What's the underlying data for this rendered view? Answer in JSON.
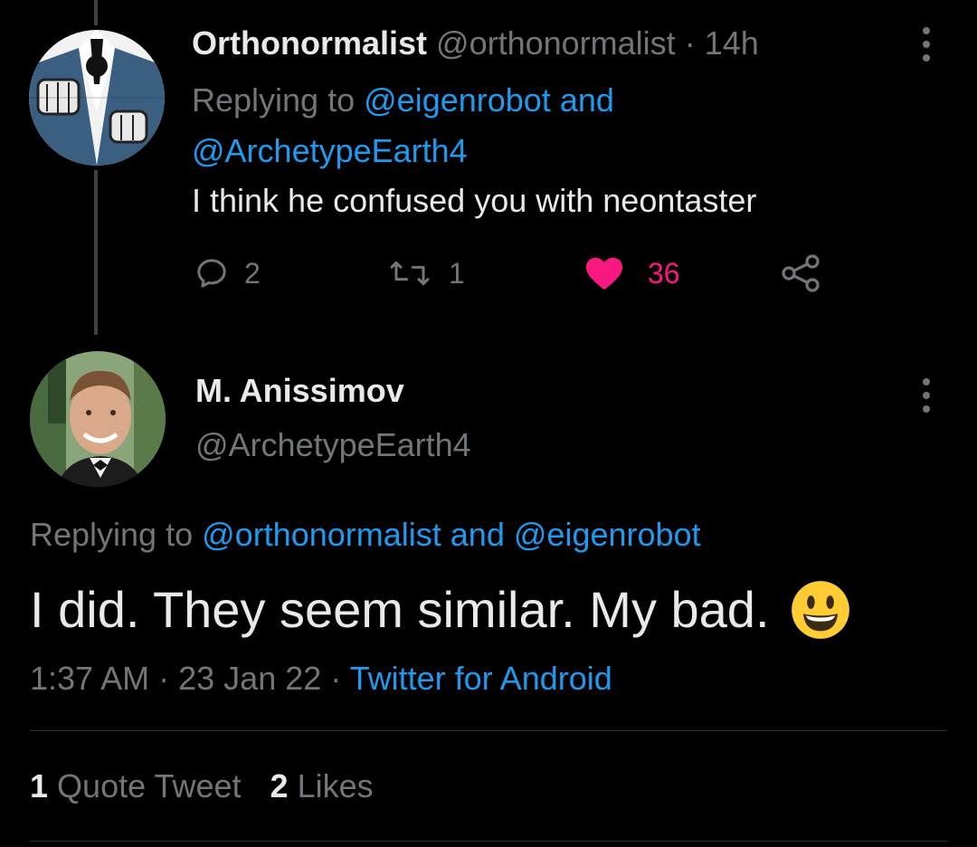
{
  "reply_tweet": {
    "display_name": "Orthonormalist",
    "handle": "@orthonormalist",
    "separator": "·",
    "time_ago": "14h",
    "replying_prefix": "Replying to",
    "replying_user_1": "@eigenrobot",
    "replying_and": "and",
    "replying_user_2": "@ArchetypeEarth4",
    "text": "I think he confused you with neontaster",
    "actions": {
      "reply_count": "2",
      "retweet_count": "1",
      "like_count": "36"
    }
  },
  "main_tweet": {
    "display_name": "M. Anissimov",
    "handle": "@ArchetypeEarth4",
    "replying_prefix": "Replying to",
    "replying_user_1": "@orthonormalist",
    "replying_and": "and",
    "replying_user_2": "@eigenrobot",
    "text": "I did. They seem similar. My bad.",
    "emoji": "smiling-face-with-open-mouth",
    "time": "1:37 AM",
    "date": "23 Jan 22",
    "separator": "·",
    "source": "Twitter for Android",
    "stats": {
      "quote_count": "1",
      "quote_label": "Quote Tweet",
      "likes_count": "2",
      "likes_label": "Likes"
    }
  },
  "colors": {
    "background": "#000000",
    "text": "#e7e9ea",
    "muted": "#71767b",
    "link": "#1d9bf0",
    "like": "#f91880",
    "divider": "#2f3336"
  }
}
